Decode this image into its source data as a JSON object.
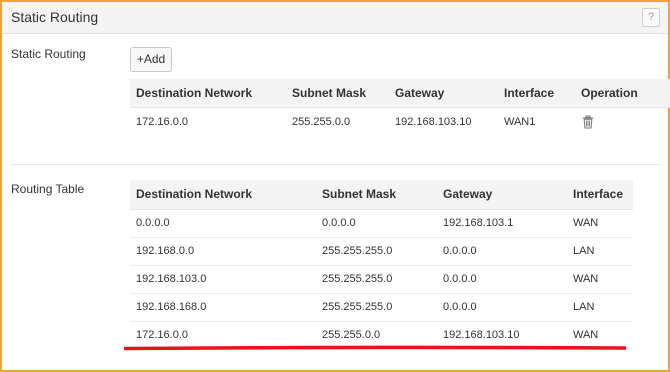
{
  "panel": {
    "title": "Static Routing",
    "help_label": "?"
  },
  "static_routing": {
    "label": "Static Routing",
    "add_label": "+Add",
    "columns": [
      "Destination Network",
      "Subnet Mask",
      "Gateway",
      "Interface",
      "Operation"
    ],
    "rows": [
      {
        "destination": "172.16.0.0",
        "mask": "255.255.0.0",
        "gateway": "192.168.103.10",
        "interface": "WAN1",
        "operation_icon": "trash-icon"
      }
    ]
  },
  "routing_table": {
    "label": "Routing Table",
    "columns": [
      "Destination Network",
      "Subnet Mask",
      "Gateway",
      "Interface"
    ],
    "rows": [
      {
        "destination": "0.0.0.0",
        "mask": "0.0.0.0",
        "gateway": "192.168.103.1",
        "interface": "WAN"
      },
      {
        "destination": "192.168.0.0",
        "mask": "255.255.255.0",
        "gateway": "0.0.0.0",
        "interface": "LAN"
      },
      {
        "destination": "192.168.103.0",
        "mask": "255.255.255.0",
        "gateway": "0.0.0.0",
        "interface": "WAN"
      },
      {
        "destination": "192.168.168.0",
        "mask": "255.255.255.0",
        "gateway": "0.0.0.0",
        "interface": "LAN"
      },
      {
        "destination": "172.16.0.0",
        "mask": "255.255.0.0",
        "gateway": "192.168.103.10",
        "interface": "WAN"
      }
    ]
  },
  "colors": {
    "panel_border": "#f0a33a",
    "highlight_underline": "#e8141b"
  }
}
